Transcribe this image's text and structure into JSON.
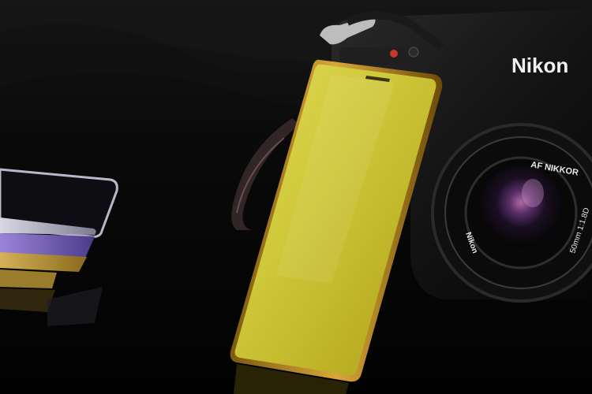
{
  "photo": {
    "camera": {
      "brand": "Nikon",
      "lens_name": "AF NIKKOR",
      "lens_brand": "Nikon",
      "lens_spec": "50mm 1:1.8D"
    },
    "colors": {
      "background": "#050505",
      "phone_gold": "#c9c12b",
      "phone_bezel": "#b08a1a",
      "camera_body": "#151515"
    }
  }
}
